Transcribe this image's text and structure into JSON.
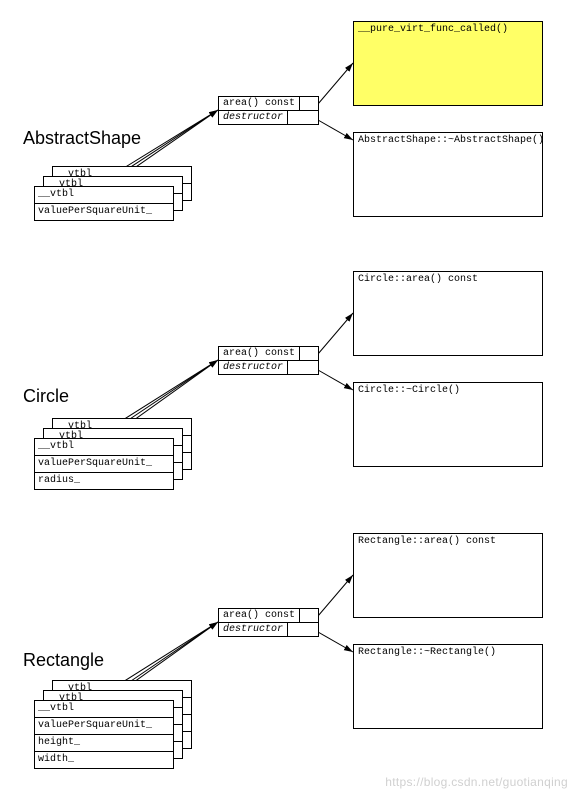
{
  "watermark": "https://blog.csdn.net/guotianqing",
  "sections": {
    "abstract": {
      "label": "AbstractShape",
      "obj_rows": [
        "__vtbl",
        "__vtbl",
        "__vtbl",
        "valuePerSquareUnit_"
      ],
      "vtable_rows": [
        "area() const",
        "destructor"
      ],
      "targets": [
        "__pure_virt_func_called()",
        "AbstractShape::~AbstractShape()"
      ]
    },
    "circle": {
      "label": "Circle",
      "obj_rows": [
        "__vtbl",
        "__vtbl",
        "__vtbl",
        "valuePerSquareUnit_",
        "radius_"
      ],
      "vtable_rows": [
        "area() const",
        "destructor"
      ],
      "targets": [
        "Circle::area() const",
        "Circle::~Circle()"
      ]
    },
    "rectangle": {
      "label": "Rectangle",
      "obj_rows": [
        "__vtbl",
        "__vtbl",
        "__vtbl",
        "valuePerSquareUnit_",
        "height_",
        "width_"
      ],
      "vtable_rows": [
        "area() const",
        "destructor"
      ],
      "targets": [
        "Rectangle::area() const",
        "Rectangle::~Rectangle()"
      ]
    }
  }
}
